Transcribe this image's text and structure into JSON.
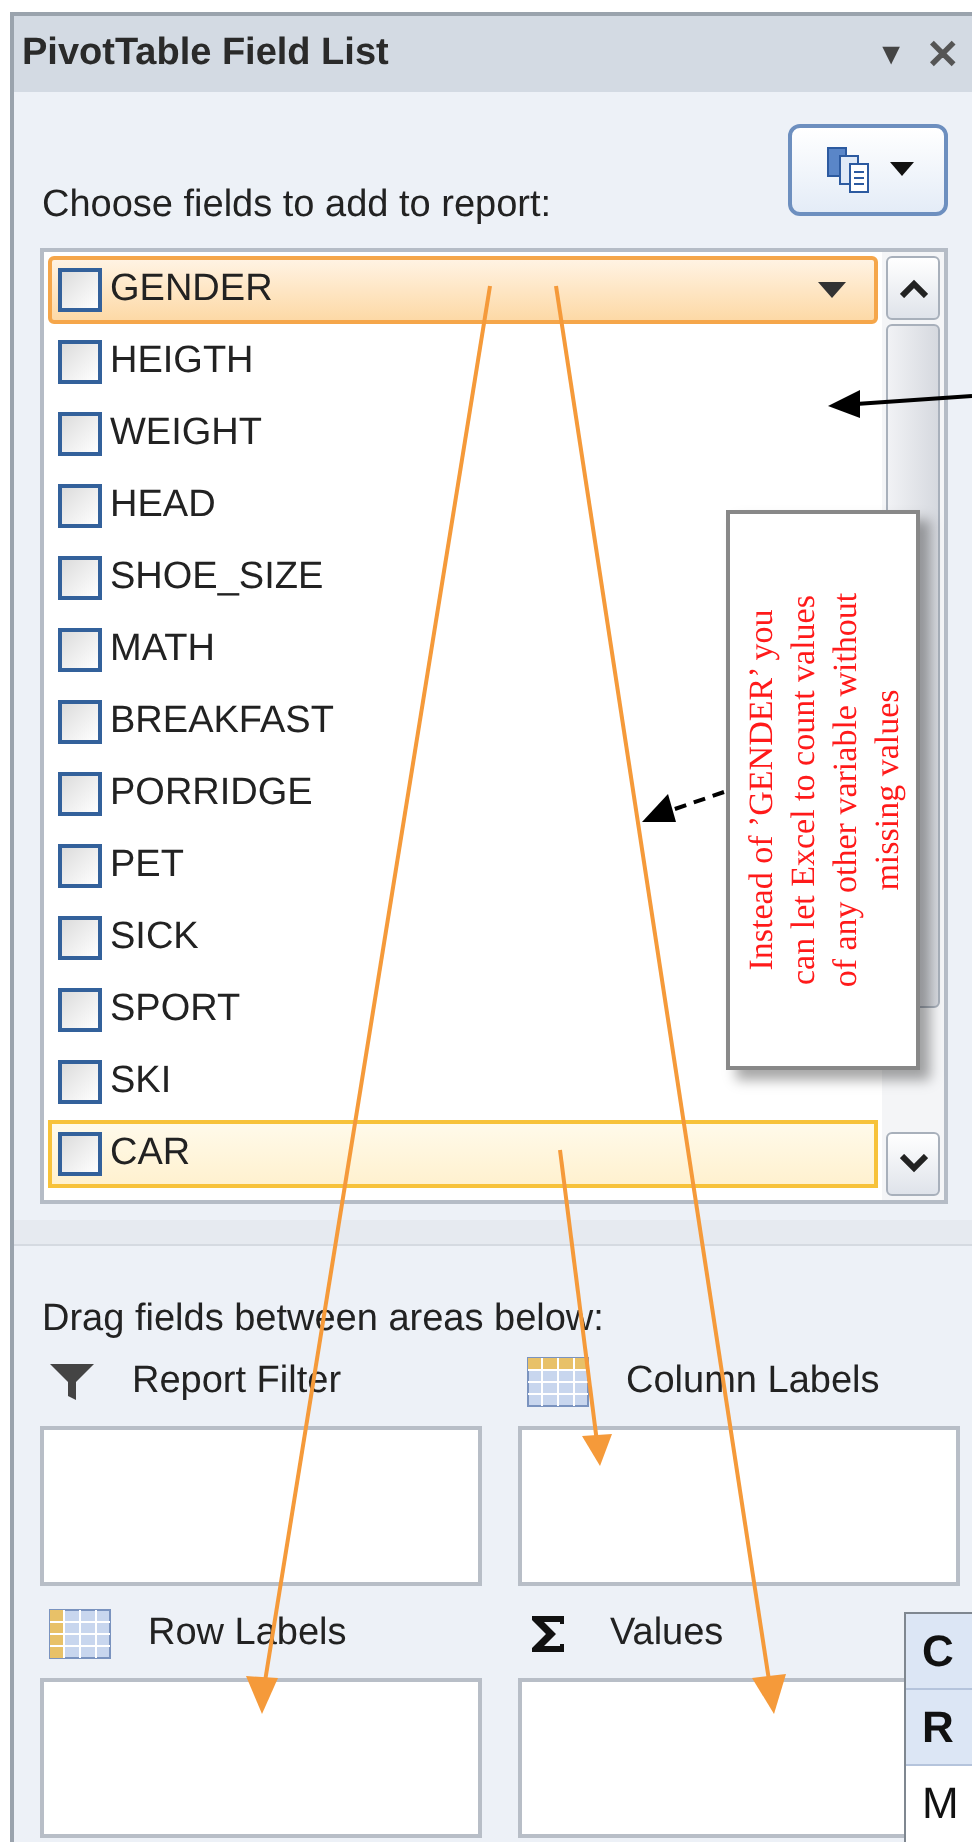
{
  "window": {
    "title": "PivotTable Field List",
    "menu_glyph": "▼",
    "close_glyph": "✕"
  },
  "choose_label": "Choose fields to add to report:",
  "fields": [
    {
      "label": "GENDER",
      "checked": false,
      "selected": true,
      "hovered": false
    },
    {
      "label": "HEIGTH",
      "checked": false,
      "selected": false,
      "hovered": false
    },
    {
      "label": "WEIGHT",
      "checked": false,
      "selected": false,
      "hovered": false
    },
    {
      "label": "HEAD",
      "checked": false,
      "selected": false,
      "hovered": false
    },
    {
      "label": "SHOE_SIZE",
      "checked": false,
      "selected": false,
      "hovered": false
    },
    {
      "label": "MATH",
      "checked": false,
      "selected": false,
      "hovered": false
    },
    {
      "label": "BREAKFAST",
      "checked": false,
      "selected": false,
      "hovered": false
    },
    {
      "label": "PORRIDGE",
      "checked": false,
      "selected": false,
      "hovered": false
    },
    {
      "label": "PET",
      "checked": false,
      "selected": false,
      "hovered": false
    },
    {
      "label": "SICK",
      "checked": false,
      "selected": false,
      "hovered": false
    },
    {
      "label": "SPORT",
      "checked": false,
      "selected": false,
      "hovered": false
    },
    {
      "label": "SKI",
      "checked": false,
      "selected": false,
      "hovered": false
    },
    {
      "label": "CAR",
      "checked": false,
      "selected": false,
      "hovered": true
    }
  ],
  "drag_label": "Drag fields between areas below:",
  "areas": [
    {
      "kind": "filter",
      "label": "Report Filter"
    },
    {
      "kind": "columns",
      "label": "Column Labels"
    },
    {
      "kind": "rows",
      "label": "Row Labels"
    },
    {
      "kind": "values",
      "label": "Values"
    }
  ],
  "sheet_cells": [
    "C",
    "R",
    "M"
  ],
  "callout": {
    "lines": [
      "Instead of ’GENDER’ you",
      "can let Excel to count values",
      "of any other variable without",
      "missing values"
    ]
  }
}
